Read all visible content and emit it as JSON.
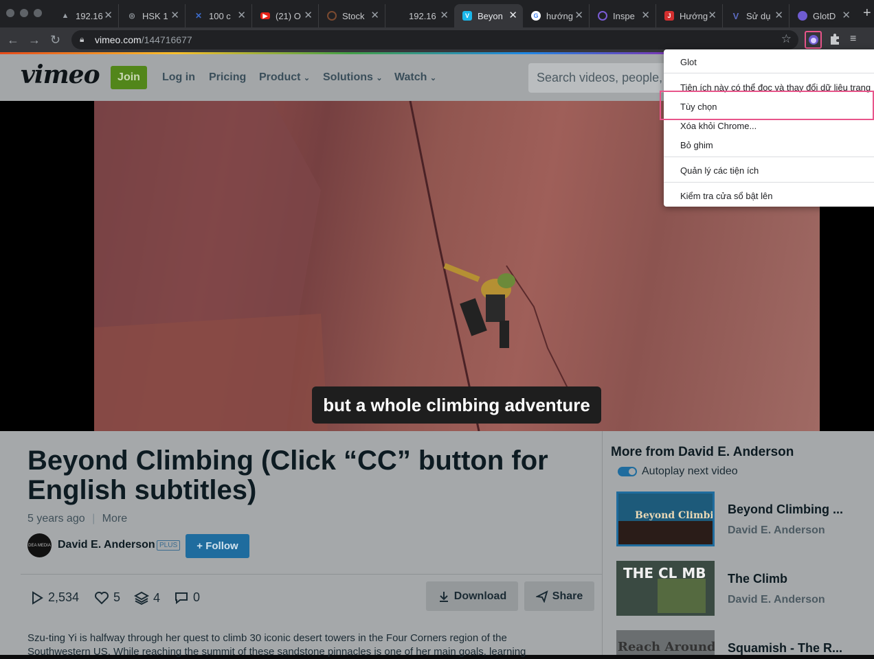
{
  "browser": {
    "tabs": [
      {
        "title": "192.16",
        "icon": "triangle-icon",
        "color": "#555"
      },
      {
        "title": "HSK 1",
        "icon": "hsk-icon",
        "color": "#777"
      },
      {
        "title": "100 c",
        "icon": "x-logo-icon",
        "color": "#3c6bc9"
      },
      {
        "title": "(21) O",
        "icon": "youtube-icon",
        "color": "#e62117"
      },
      {
        "title": "Stock",
        "icon": "stock-icon",
        "color": "#7a4a30"
      },
      {
        "title": "192.16",
        "icon": "blank-icon",
        "color": "#333"
      },
      {
        "title": "Beyon",
        "icon": "vimeo-icon",
        "color": "#1ab7ea"
      },
      {
        "title": "hướng",
        "icon": "google-icon",
        "color": "#4285f4"
      },
      {
        "title": "Inspe",
        "icon": "inspect-icon",
        "color": "#7b5cd6"
      },
      {
        "title": "Hướng",
        "icon": "j-icon",
        "color": "#d32f2f"
      },
      {
        "title": "Sử dụ",
        "icon": "v-icon",
        "color": "#3f51b5"
      },
      {
        "title": "GlotD",
        "icon": "glot-icon",
        "color": "#6f5cd1"
      }
    ],
    "url_domain": "vimeo.com",
    "url_path": "/144716677"
  },
  "vimeo": {
    "logo": "vimeo",
    "join": "Join",
    "nav": {
      "login": "Log in",
      "pricing": "Pricing",
      "product": "Product",
      "solutions": "Solutions",
      "watch": "Watch"
    },
    "search_placeholder": "Search videos, people,"
  },
  "video": {
    "subtitle": "but a whole climbing adventure",
    "title": "Beyond Climbing (Click “CC” button for English subtitles)",
    "age": "5 years ago",
    "more": "More",
    "author": "David E. Anderson",
    "avatar_text": "DEA MEDIA",
    "plus_badge": "PLUS",
    "follow": "+ Follow",
    "plays": "2,534",
    "likes": "5",
    "collections": "4",
    "comments": "0",
    "download": "Download",
    "share": "Share",
    "description": "Szu-ting Yi is halfway through her quest to climb 30 iconic desert towers in the Four Corners region of the Southwestern US. While reaching the summit of these sandstone pinnacles is one of her main goals, learning"
  },
  "sidebar": {
    "heading": "More from David E. Anderson",
    "autoplay": "Autoplay next video",
    "items": [
      {
        "title": "Beyond Climbing ...",
        "author": "David E. Anderson",
        "thumb_text": "Beyond Climbing"
      },
      {
        "title": "The Climb",
        "author": "David E. Anderson",
        "thumb_text": "THE CL MB"
      },
      {
        "title": "Squamish - The R...",
        "author": "",
        "thumb_text": "Reach Around"
      }
    ]
  },
  "context_menu": {
    "items": [
      "Glot",
      "Tiện ích này có thể đọc và thay đổi dữ liệu trang",
      "Tùy chọn",
      "Xóa khỏi Chrome...",
      "Bỏ ghim",
      "Quản lý các tiện ích",
      "Kiểm tra cửa sổ bật lên"
    ]
  },
  "colors": {
    "highlight": "#e8548a",
    "vimeo_green": "#52861a",
    "follow_blue": "#1f6c9e"
  }
}
